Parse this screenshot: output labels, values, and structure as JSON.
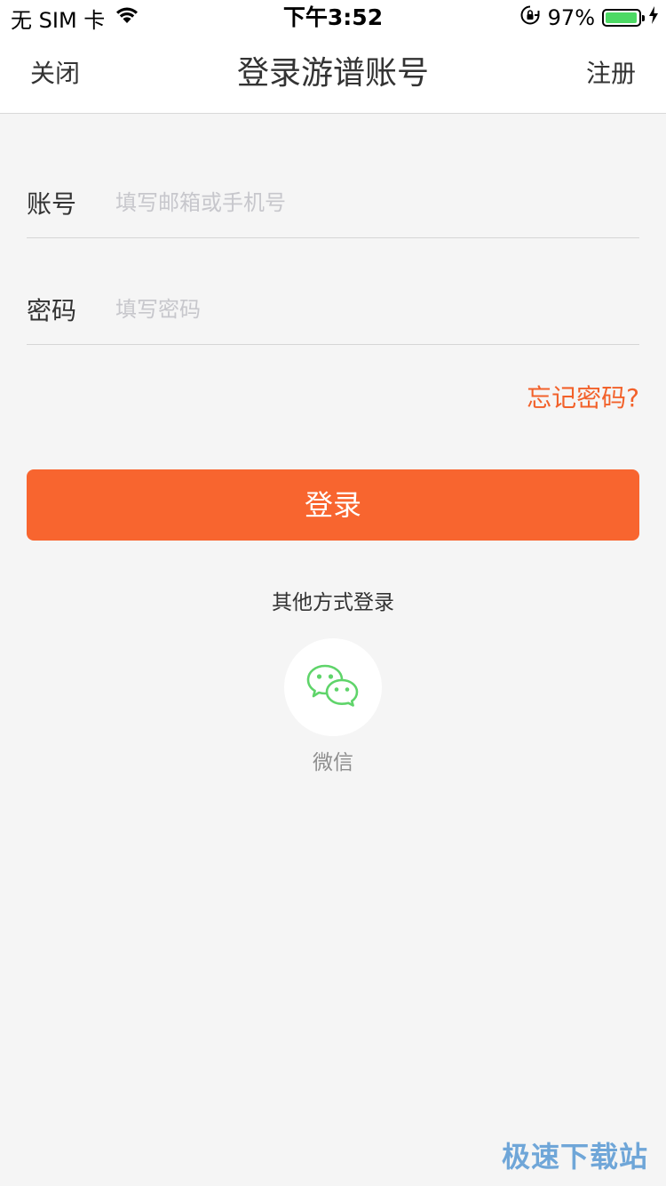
{
  "status_bar": {
    "carrier": "无 SIM 卡",
    "time": "下午3:52",
    "battery_percent": "97%",
    "battery_level": 0.97,
    "battery_color": "#4cd964",
    "icons": [
      "wifi-icon",
      "rotation-lock-icon",
      "battery-icon",
      "charging-bolt-icon"
    ]
  },
  "nav": {
    "close_label": "关闭",
    "title": "登录游谱账号",
    "register_label": "注册"
  },
  "form": {
    "account": {
      "label": "账号",
      "placeholder": "填写邮箱或手机号",
      "value": ""
    },
    "password": {
      "label": "密码",
      "placeholder": "填写密码",
      "value": ""
    },
    "forgot_label": "忘记密码?",
    "login_label": "登录"
  },
  "other_login": {
    "title": "其他方式登录",
    "wechat_label": "微信",
    "wechat_icon": "wechat-icon",
    "wechat_color": "#5fd46a"
  },
  "colors": {
    "accent": "#f8652f",
    "link": "#f2612a",
    "background": "#f5f5f5"
  },
  "watermark": "极速下载站"
}
